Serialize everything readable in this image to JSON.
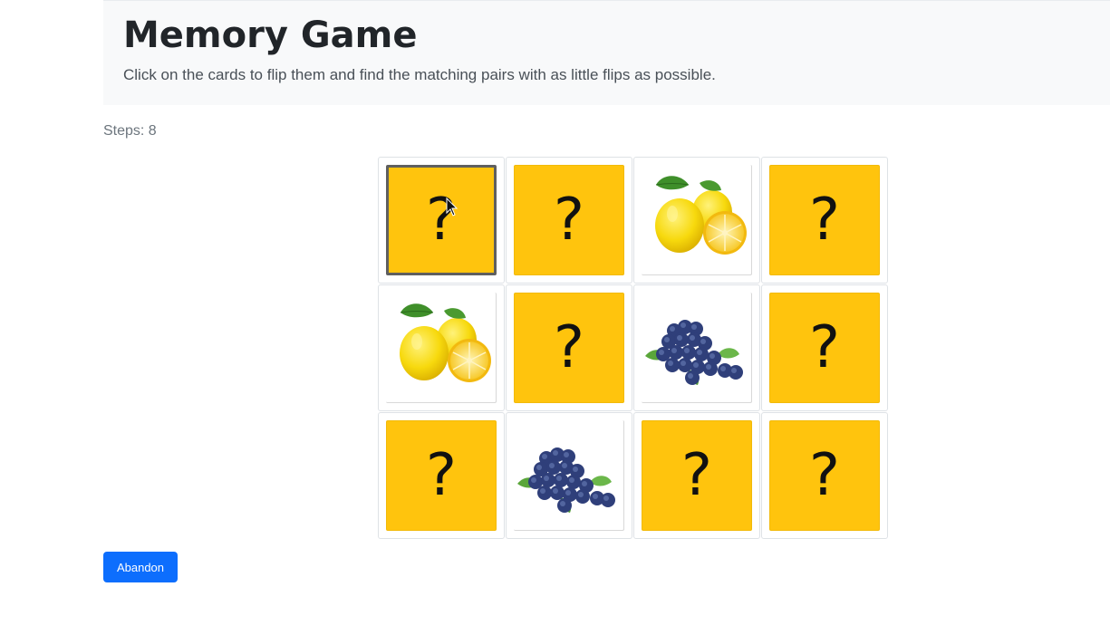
{
  "header": {
    "title": "Memory Game",
    "subtitle": "Click on the cards to flip them and find the matching pairs with as little flips as possible."
  },
  "status": {
    "steps_label": "Steps: 8"
  },
  "board": {
    "rows": 3,
    "columns": 4,
    "hidden_symbol": "?",
    "cards": [
      {
        "state": "hidden",
        "fruit": null,
        "focused": true
      },
      {
        "state": "hidden",
        "fruit": null
      },
      {
        "state": "shown",
        "fruit": "lemon"
      },
      {
        "state": "hidden",
        "fruit": null
      },
      {
        "state": "shown",
        "fruit": "lemon"
      },
      {
        "state": "hidden",
        "fruit": null
      },
      {
        "state": "shown",
        "fruit": "blueberries"
      },
      {
        "state": "hidden",
        "fruit": null
      },
      {
        "state": "hidden",
        "fruit": null
      },
      {
        "state": "shown",
        "fruit": "blueberries"
      },
      {
        "state": "hidden",
        "fruit": null
      },
      {
        "state": "hidden",
        "fruit": null
      }
    ]
  },
  "actions": {
    "abandon_label": "Abandon"
  },
  "colors": {
    "card_back": "#ffc40d",
    "button": "#0d6efd",
    "header_bg": "#f8f9fa"
  }
}
